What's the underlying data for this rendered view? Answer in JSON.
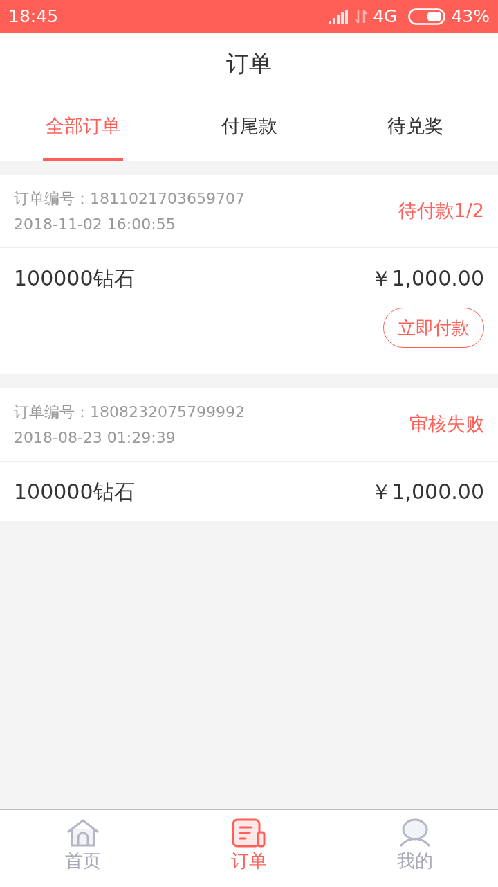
{
  "status_bar": {
    "time": "18:45",
    "network": "4G",
    "battery": "43%"
  },
  "title": "订单",
  "tabs": [
    {
      "label": "全部订单",
      "selected": true
    },
    {
      "label": "付尾款",
      "selected": false
    },
    {
      "label": "待兑奖",
      "selected": false
    }
  ],
  "orders": [
    {
      "number": "订单编号：1811021703659707",
      "date": "2018-11-02 16:00:55",
      "status": "待付款1/2",
      "item": "100000钻石",
      "price": "￥1,000.00",
      "actions": [
        "立即付款"
      ]
    },
    {
      "number": "订单编号：1808232075799992",
      "date": "2018-08-23 01:29:39",
      "status": "审核失败",
      "item": "100000钻石",
      "price": "￥1,000.00"
    }
  ],
  "bottom_nav": [
    {
      "kind": "home",
      "label": "首页",
      "selected": false
    },
    {
      "kind": "orders",
      "label": "订单",
      "selected": true
    },
    {
      "kind": "profile",
      "label": "我的",
      "selected": false
    }
  ]
}
